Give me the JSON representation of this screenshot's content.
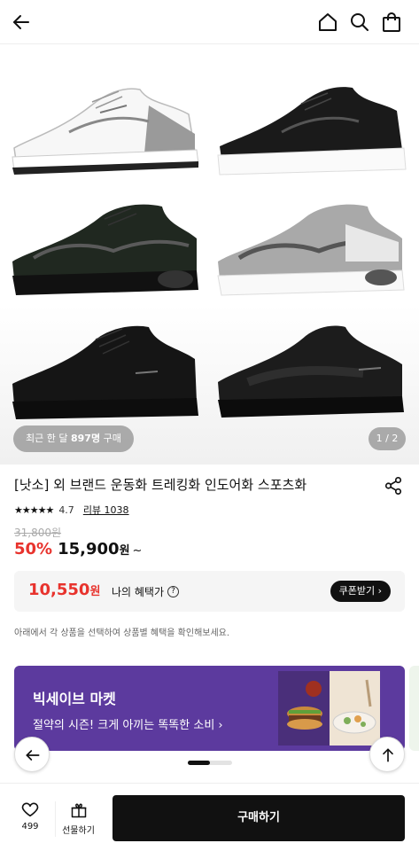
{
  "header": {
    "icons": [
      "back-arrow-icon",
      "home-icon",
      "search-icon",
      "shopping-bag-icon"
    ]
  },
  "hero": {
    "shoe_colors": [
      "white-gray",
      "black-white-sole",
      "black-dark-green",
      "gray-white",
      "all-black",
      "black-knit"
    ],
    "badge_prefix": "최근 한 달",
    "badge_count": "897명",
    "badge_suffix": "구매",
    "page_indicator": "1 / 2"
  },
  "product": {
    "title": "[낫소] 외 브랜드 운동화 트레킹화 인도어화 스포츠화",
    "stars": "★★★★★",
    "rating": "4.7",
    "review_link": "리뷰 1038",
    "original_price": "31,800원",
    "discount": "50%",
    "price": "15,900",
    "price_unit": "원",
    "price_suffix": "~"
  },
  "benefit": {
    "price": "10,550",
    "unit": "원",
    "label": "나의 혜택가",
    "help": "?",
    "coupon_button": "쿠폰받기 ›"
  },
  "notice": "아래에서 각 상품을 선택하여 상품별 혜택을 확인해보세요.",
  "banner": {
    "title": "빅세이브 마켓",
    "subtitle": "절약의 시즌! 크게 아끼는 똑똑한 소비 ›",
    "background": "#5c3a9e",
    "progress": 0.5
  },
  "bottom_bar": {
    "like_count": "499",
    "gift_label": "선물하기",
    "buy_button": "구매하기"
  },
  "colors": {
    "accent_red": "#e8332d",
    "dark": "#111111"
  }
}
